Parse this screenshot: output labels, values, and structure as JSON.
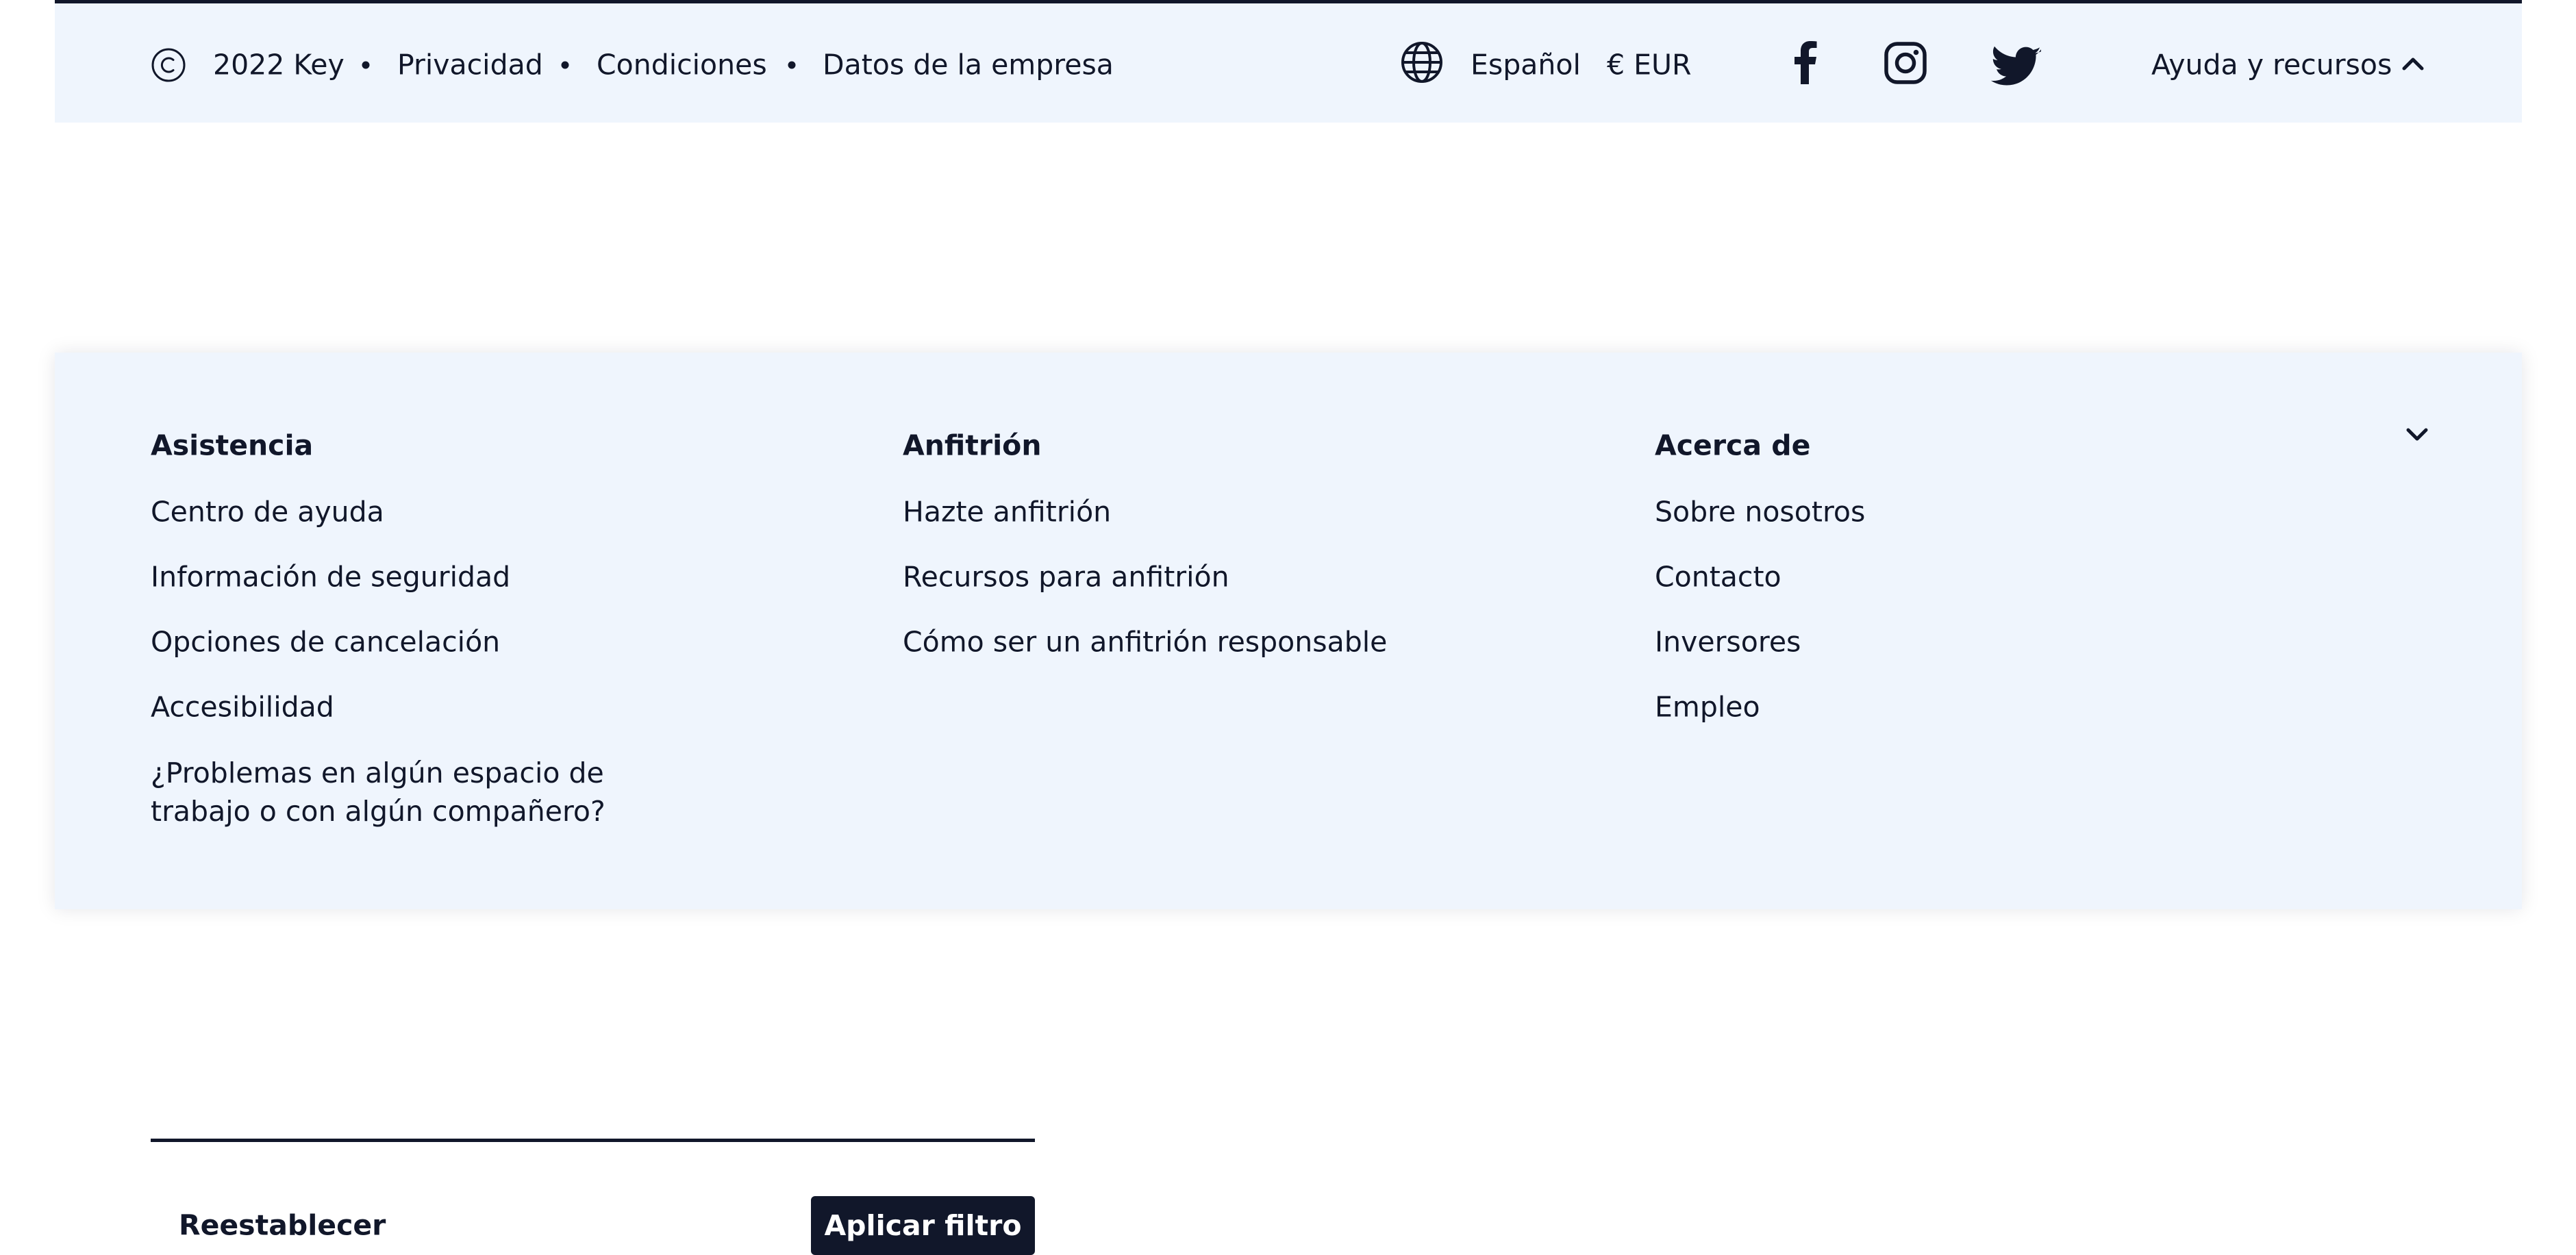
{
  "footer_bar": {
    "copyright_year": "2022 Key",
    "links": [
      "Privacidad",
      "Condiciones",
      "Datos de la empresa"
    ],
    "language": "Español",
    "currency": "€ EUR",
    "help_resources": "Ayuda y recursos",
    "icons": {
      "copyright": "copyright-icon",
      "globe": "globe-icon",
      "facebook": "facebook-icon",
      "instagram": "instagram-icon",
      "twitter": "twitter-icon",
      "help_chevron": "chevron-up-icon"
    }
  },
  "panel": {
    "columns": [
      {
        "title": "Asistencia",
        "links": [
          "Centro de ayuda",
          "Información de seguridad",
          "Opciones de cancelación",
          "Accesibilidad",
          "¿Problemas en algún espacio de trabajo o con algún compañero?"
        ]
      },
      {
        "title": "Anfitrión",
        "links": [
          "Hazte anfitrión",
          "Recursos para anfitrión",
          "Cómo ser un anfitrión responsable"
        ]
      },
      {
        "title": "Acerca de",
        "links": [
          "Sobre nosotros",
          "Contacto",
          "Inversores",
          "Empleo"
        ]
      }
    ],
    "collapse_icon": "chevron-down-icon"
  },
  "filter_actions": {
    "reset_label": "Reestablecer",
    "apply_label": "Aplicar filtro"
  },
  "colors": {
    "text": "#11172a",
    "footer_background": "#eff5fd",
    "primary_button": "#11172a"
  }
}
